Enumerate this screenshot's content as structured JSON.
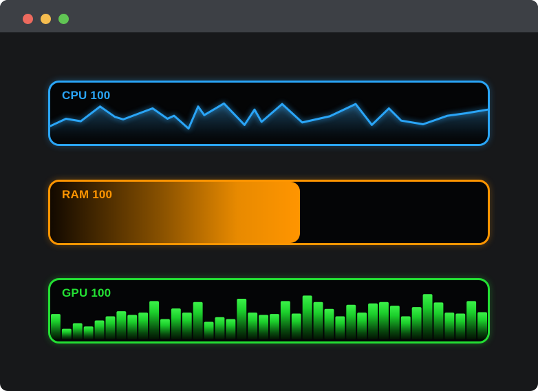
{
  "window": {
    "title": "",
    "titlebar_color": "#3d4045",
    "body_color": "#17181a",
    "controls": {
      "close_color": "#ed6a5e",
      "minimize_color": "#f5bd4f",
      "zoom_color": "#61c554"
    }
  },
  "widgets": {
    "cpu": {
      "label": "CPU 100",
      "accent": "#2aa5f7"
    },
    "ram": {
      "label": "RAM 100",
      "accent": "#ff9500",
      "fill_percent": 57
    },
    "gpu": {
      "label": "GPU 100",
      "accent": "#23df33"
    }
  },
  "chart_data": [
    {
      "type": "line",
      "title": "CPU 100",
      "ylim": [
        0,
        100
      ],
      "grid": false,
      "legend": "none",
      "series": [
        {
          "name": "CPU",
          "x": [
            0,
            3.6,
            7,
            11.4,
            14.8,
            16.7,
            23.4,
            26.8,
            28.3,
            31.6,
            33.8,
            35.2,
            39.7,
            44.4,
            46.7,
            48.3,
            53,
            57.6,
            63.9,
            69.8,
            73.5,
            77.4,
            80.2,
            85.2,
            90.8,
            95,
            100
          ],
          "values": [
            29,
            41,
            37,
            61,
            44,
            40,
            58,
            41,
            46,
            25,
            61,
            47,
            66,
            31,
            56,
            36,
            65,
            35,
            45,
            65,
            31,
            58,
            38,
            32,
            46,
            50,
            56
          ]
        }
      ]
    },
    {
      "type": "bar",
      "title": "RAM 100",
      "orientation": "horizontal-gauge",
      "ylim": [
        0,
        100
      ],
      "values": [
        57
      ]
    },
    {
      "type": "bar",
      "title": "GPU 100",
      "ylim": [
        0,
        100
      ],
      "grid": false,
      "values": [
        55,
        23,
        35,
        28,
        41,
        50,
        61,
        53,
        58,
        83,
        44,
        67,
        58,
        81,
        38,
        48,
        44,
        88,
        58,
        53,
        55,
        83,
        56,
        95,
        81,
        66,
        50,
        75,
        58,
        78,
        81,
        73,
        50,
        70,
        98,
        80,
        58,
        56,
        83,
        59
      ]
    }
  ]
}
